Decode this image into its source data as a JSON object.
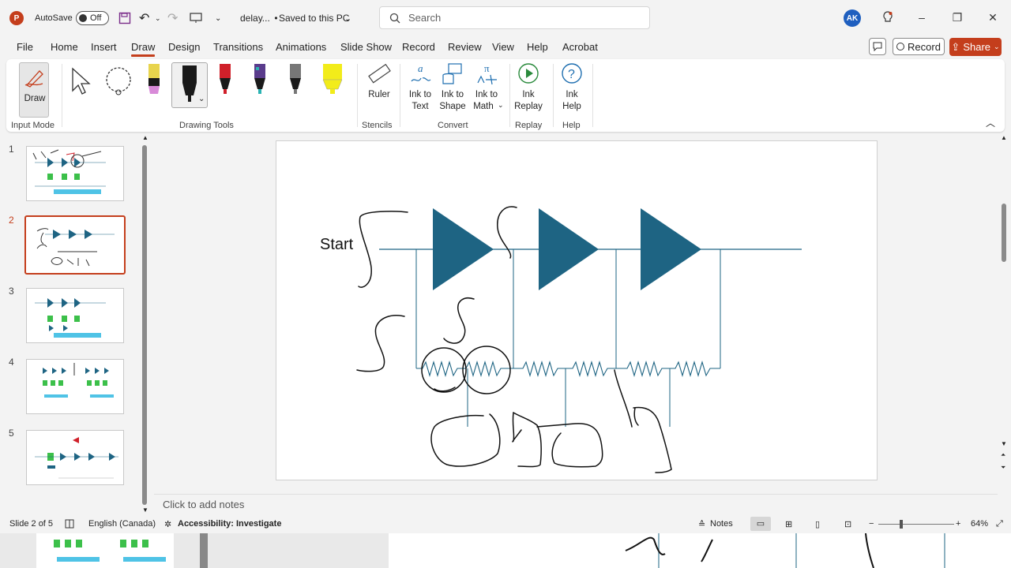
{
  "titlebar": {
    "autosave_label": "AutoSave",
    "autosave_state": "Off",
    "doc_title": "delay...",
    "save_status": "Saved to this PC",
    "search_placeholder": "Search",
    "user_initials": "AK"
  },
  "menu": {
    "items": [
      "File",
      "Home",
      "Insert",
      "Draw",
      "Design",
      "Transitions",
      "Animations",
      "Slide Show",
      "Record",
      "Review",
      "View",
      "Help",
      "Acrobat"
    ],
    "active": "Draw",
    "record_label": "Record",
    "share_label": "Share"
  },
  "ribbon": {
    "draw_label": "Draw",
    "groups": {
      "input_mode": "Input Mode",
      "drawing_tools": "Drawing Tools",
      "stencils": "Stencils",
      "convert": "Convert",
      "replay": "Replay",
      "help": "Help"
    },
    "ruler": "Ruler",
    "ink_to_text": [
      "Ink to",
      "Text"
    ],
    "ink_to_shape": [
      "Ink to",
      "Shape"
    ],
    "ink_to_math": [
      "Ink to",
      "Math"
    ],
    "ink_replay": [
      "Ink",
      "Replay"
    ],
    "ink_help": [
      "Ink",
      "Help"
    ],
    "pen_colors": [
      "#e8d44d",
      "#1a1a1a",
      "#d0202a",
      "#2bb3b3",
      "#777777",
      "#f2ec1a"
    ]
  },
  "slides": {
    "numbers": [
      "1",
      "2",
      "3",
      "4",
      "5"
    ],
    "selected": 2
  },
  "slide": {
    "start_label": "Start",
    "accent": "#1e6483"
  },
  "notes": {
    "placeholder": "Click to add notes"
  },
  "status": {
    "slide_info": "Slide 2 of 5",
    "language": "English (Canada)",
    "accessibility": "Accessibility: Investigate",
    "notes_label": "Notes",
    "zoom": "64%"
  }
}
